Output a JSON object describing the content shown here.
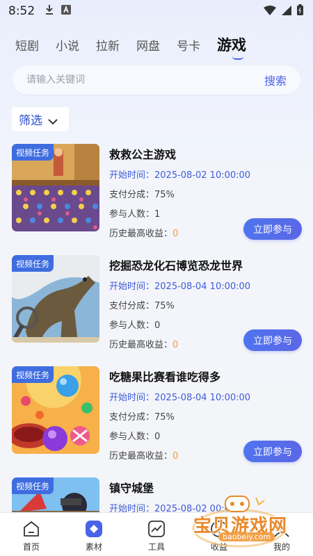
{
  "status": {
    "time": "8:52"
  },
  "tabs": [
    {
      "label": "短剧"
    },
    {
      "label": "小说"
    },
    {
      "label": "拉新"
    },
    {
      "label": "网盘"
    },
    {
      "label": "号卡"
    },
    {
      "label": "游戏",
      "active": true
    }
  ],
  "search": {
    "placeholder": "请输入关键词",
    "button": "搜索"
  },
  "filter": {
    "label": "筛选"
  },
  "cards": [
    {
      "badge": "视频任务",
      "title": "救救公主游戏",
      "start": "开始时间：2025-08-02 10:00:00",
      "share": "支付分成：75%",
      "participants": "参与人数：1",
      "income_label": "历史最高收益：",
      "income_value": "0",
      "join": "立即参与"
    },
    {
      "badge": "视频任务",
      "title": "挖掘恐龙化石博览恐龙世界",
      "start": "开始时间：2025-08-04 10:00:00",
      "share": "支付分成：75%",
      "participants": "参与人数：0",
      "income_label": "历史最高收益：",
      "income_value": "0",
      "join": "立即参与"
    },
    {
      "badge": "视频任务",
      "title": "吃糖果比赛看谁吃得多",
      "start": "开始时间：2025-08-04 10:00:00",
      "share": "支付分成：75%",
      "participants": "参与人数：0",
      "income_label": "历史最高收益：",
      "income_value": "0",
      "join": "立即参与"
    },
    {
      "badge": "视频任务",
      "title": "镇守城堡",
      "start": "开始时间：2025-08-02 00:00",
      "share": "",
      "participants": "",
      "income_label": "",
      "income_value": "",
      "join": ""
    }
  ],
  "nav": [
    {
      "label": "首页",
      "icon": "home-icon"
    },
    {
      "label": "素材",
      "icon": "material-icon",
      "active": true
    },
    {
      "label": "工具",
      "icon": "tools-icon"
    },
    {
      "label": "收益",
      "icon": "earnings-icon"
    },
    {
      "label": "我的",
      "icon": "profile-icon"
    }
  ],
  "watermark": {
    "title": "宝贝游戏网",
    "url": "baobeiy.com"
  },
  "colors": {
    "accent": "#4a63e8",
    "badge": "#3f6de0",
    "income_zero": "#f29b38"
  }
}
